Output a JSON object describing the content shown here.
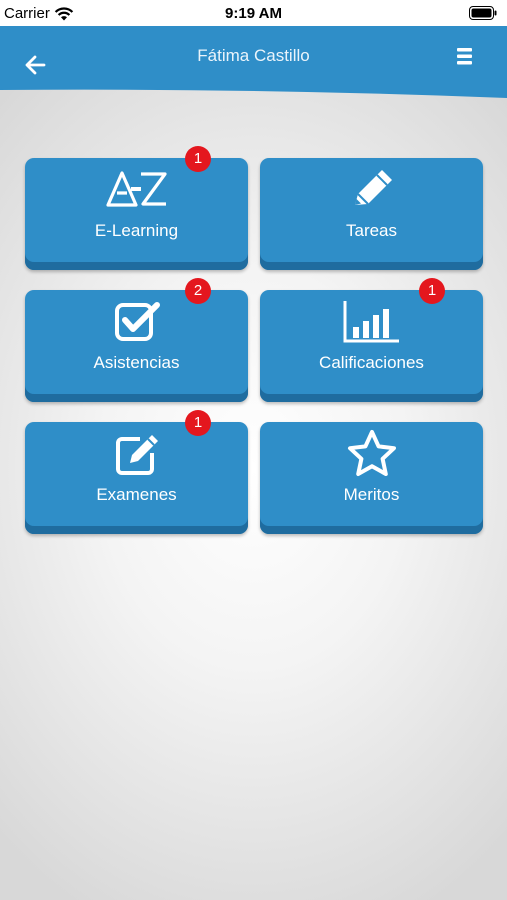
{
  "status_bar": {
    "carrier": "Carrier",
    "time": "9:19 AM"
  },
  "header": {
    "title": "Fátima Castillo"
  },
  "colors": {
    "accent": "#2f8ec8",
    "accent_dark": "#1f6c9f",
    "badge": "#e4171e"
  },
  "tiles": [
    {
      "label": "E-Learning",
      "icon": "az-icon",
      "badge": "1"
    },
    {
      "label": "Tareas",
      "icon": "pencil-icon",
      "badge": ""
    },
    {
      "label": "Asistencias",
      "icon": "checkbox-icon",
      "badge": "2"
    },
    {
      "label": "Calificaciones",
      "icon": "bar-chart-icon",
      "badge": "1"
    },
    {
      "label": "Examenes",
      "icon": "edit-icon",
      "badge": "1"
    },
    {
      "label": "Meritos",
      "icon": "star-icon",
      "badge": ""
    }
  ]
}
